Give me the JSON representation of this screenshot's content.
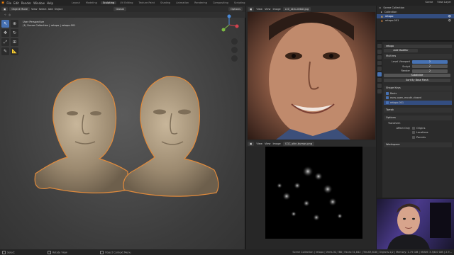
{
  "menubar": {
    "items": [
      "File",
      "Edit",
      "Render",
      "Window",
      "Help"
    ],
    "workspaces": [
      "Layout",
      "Modeling",
      "Sculpting",
      "UV Editing",
      "Texture Paint",
      "Shading",
      "Animation",
      "Rendering",
      "Compositing",
      "Scripting"
    ],
    "active_workspace": "Sculpting",
    "scene": "Scene",
    "view_layer": "View Layer"
  },
  "viewport": {
    "mode": "Object Mode",
    "view_menu": [
      "View",
      "Select",
      "Add",
      "Object"
    ],
    "transform": "Global",
    "options": "Options",
    "info_line1": "User Perspective",
    "info_line2": "(1) Scene Collection | retopo | retopo.001"
  },
  "image_editor_top": {
    "menus": [
      "View",
      "View",
      "Image"
    ],
    "filename": "cc0_skin-detail.jpg"
  },
  "image_editor_bottom": {
    "menus": [
      "View",
      "View",
      "Image"
    ],
    "filename": "CGC_skin-bumps.png"
  },
  "outliner": {
    "title": "Scene Collection",
    "rows": [
      {
        "label": "Collection",
        "selected": false
      },
      {
        "label": "retopo",
        "selected": true
      },
      {
        "label": "retopo.001",
        "selected": false
      }
    ]
  },
  "properties": {
    "object_name": "retopo",
    "section_modifier": "Add Modifier",
    "modifier_name": "Multires",
    "level_viewport_label": "Level Viewport",
    "level_viewport_value": "2",
    "sculpt_label": "Sculpt",
    "sculpt_value": "2",
    "render_label": "Render",
    "render_value": "2",
    "subdivide_button": "Subdivide",
    "sort_by_base": "Sort By Base Mesh",
    "shape_keys": "Shape Keys",
    "shape_key_1": "Basis",
    "shape_key_2": "eyes-open_mouth-closed",
    "shape_key_3": "retopo.001",
    "tweak": "Tweak",
    "options": "Options",
    "transform": "Transform",
    "affect_only": "Affect Only",
    "origins": "Origins",
    "locations": "Locations",
    "parents": "Parents",
    "workspace": "Workspace"
  },
  "statusbar": {
    "select": "Select",
    "rotate": "Rotate View",
    "context": "Object Context Menu",
    "stats": "Scene Collection | retopo | Verts:32,788 | Faces:31,842 | Tris:63,618 | Objects:1/2 | Memory: 1.75 GiB | VRAM: 3.3/8.0 GiB | 2.9..."
  },
  "colors": {
    "accent": "#4772b3",
    "outline_selected": "#e08a3c",
    "active_object": "#f0b040"
  }
}
